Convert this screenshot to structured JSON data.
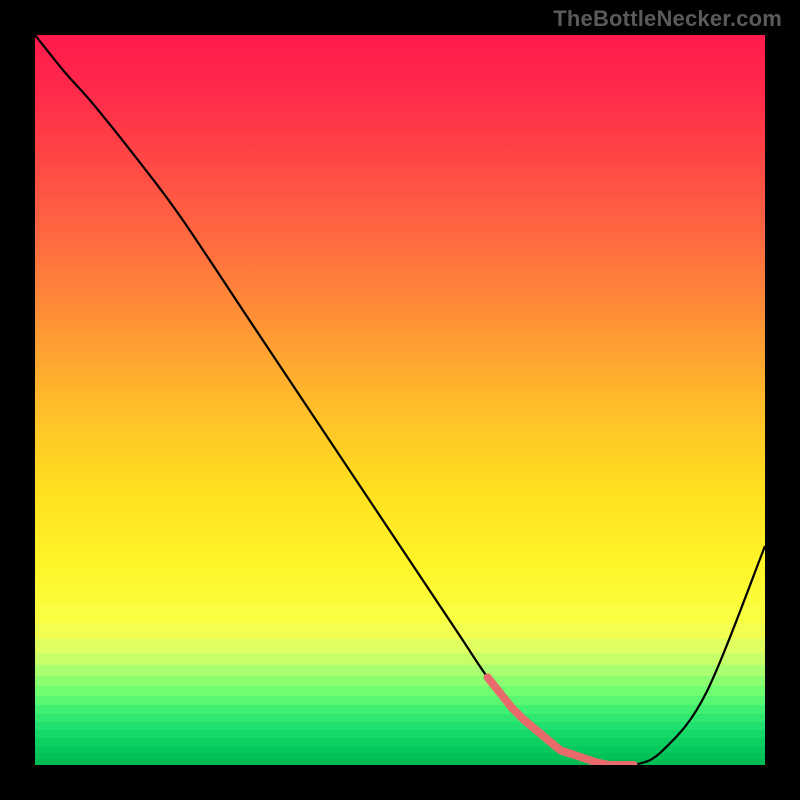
{
  "watermark": "TheBottleNecker.com",
  "chart_data": {
    "type": "line",
    "title": "",
    "xlabel": "",
    "ylabel": "",
    "xlim": [
      0,
      100
    ],
    "ylim": [
      0,
      100
    ],
    "x": [
      0,
      4,
      8,
      14,
      20,
      30,
      40,
      50,
      58,
      62,
      66,
      72,
      78,
      82,
      86,
      92,
      100
    ],
    "values": [
      100,
      95,
      90.5,
      83,
      75,
      60,
      45,
      30,
      18,
      12,
      7,
      2,
      0,
      0,
      2,
      10,
      30
    ],
    "highlight_segment": {
      "x_start": 62,
      "x_end": 82,
      "color": "#e86a6a",
      "width": 8
    },
    "gradient_stops": [
      {
        "pct": 0,
        "color": "#ff1a4d"
      },
      {
        "pct": 50,
        "color": "#ffc828"
      },
      {
        "pct": 85,
        "color": "#f0ff50"
      },
      {
        "pct": 100,
        "color": "#00c060"
      }
    ]
  }
}
